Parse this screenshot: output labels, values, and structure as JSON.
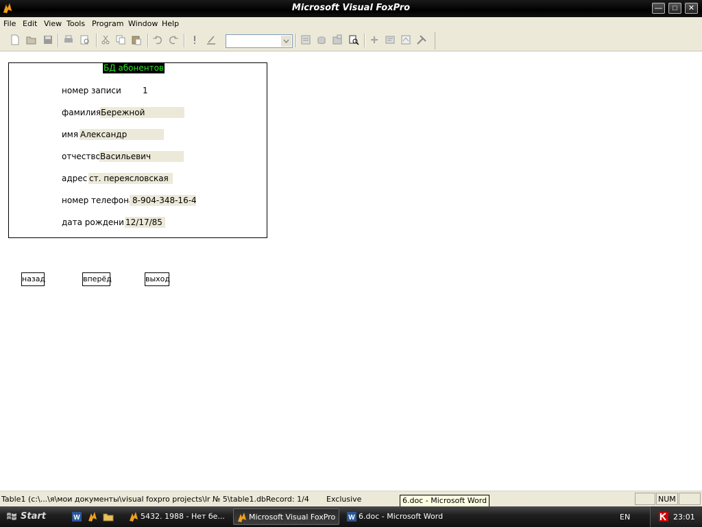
{
  "window": {
    "title": "Microsoft Visual FoxPro",
    "minimize": "—",
    "maximize": "□",
    "close": "✕"
  },
  "menu": [
    "File",
    "Edit",
    "View",
    "Tools",
    "Program",
    "Window",
    "Help"
  ],
  "toolbar": {
    "combo_value": ""
  },
  "form": {
    "title": "БД абонентов",
    "fields": [
      {
        "label": "номер записи",
        "value": "1"
      },
      {
        "label": "фамилия",
        "value": "Бережной"
      },
      {
        "label": "имя",
        "value": "Александр"
      },
      {
        "label": "отчество",
        "value": "Васильевич"
      },
      {
        "label": "адрес",
        "value": "ст. переясловская"
      },
      {
        "label": "номер телефона",
        "value": "8-904-348-16-4"
      },
      {
        "label": "дата рождения",
        "value": "12/17/85"
      }
    ],
    "buttons": {
      "back": "назад",
      "forward": "вперёд",
      "exit": "выход"
    }
  },
  "statusbar": {
    "path": "Table1 (c:\\...\\я\\мои документы\\visual foxpro projects\\lr № 5\\table1.dbRecord: 1/4",
    "mode": "Exclusive",
    "num": "NUM",
    "tooltip": "6.doc - Microsoft Word"
  },
  "taskbar": {
    "start": "Start",
    "tasks": [
      {
        "label": "5432. 1988 - Нет бе...",
        "icon": "foxpro-icon",
        "active": false
      },
      {
        "label": "Microsoft Visual FoxPro",
        "icon": "foxpro-icon",
        "active": true
      },
      {
        "label": "6.doc - Microsoft Word",
        "icon": "word-icon",
        "active": false
      }
    ],
    "lang": "EN",
    "clock": "23:01"
  }
}
